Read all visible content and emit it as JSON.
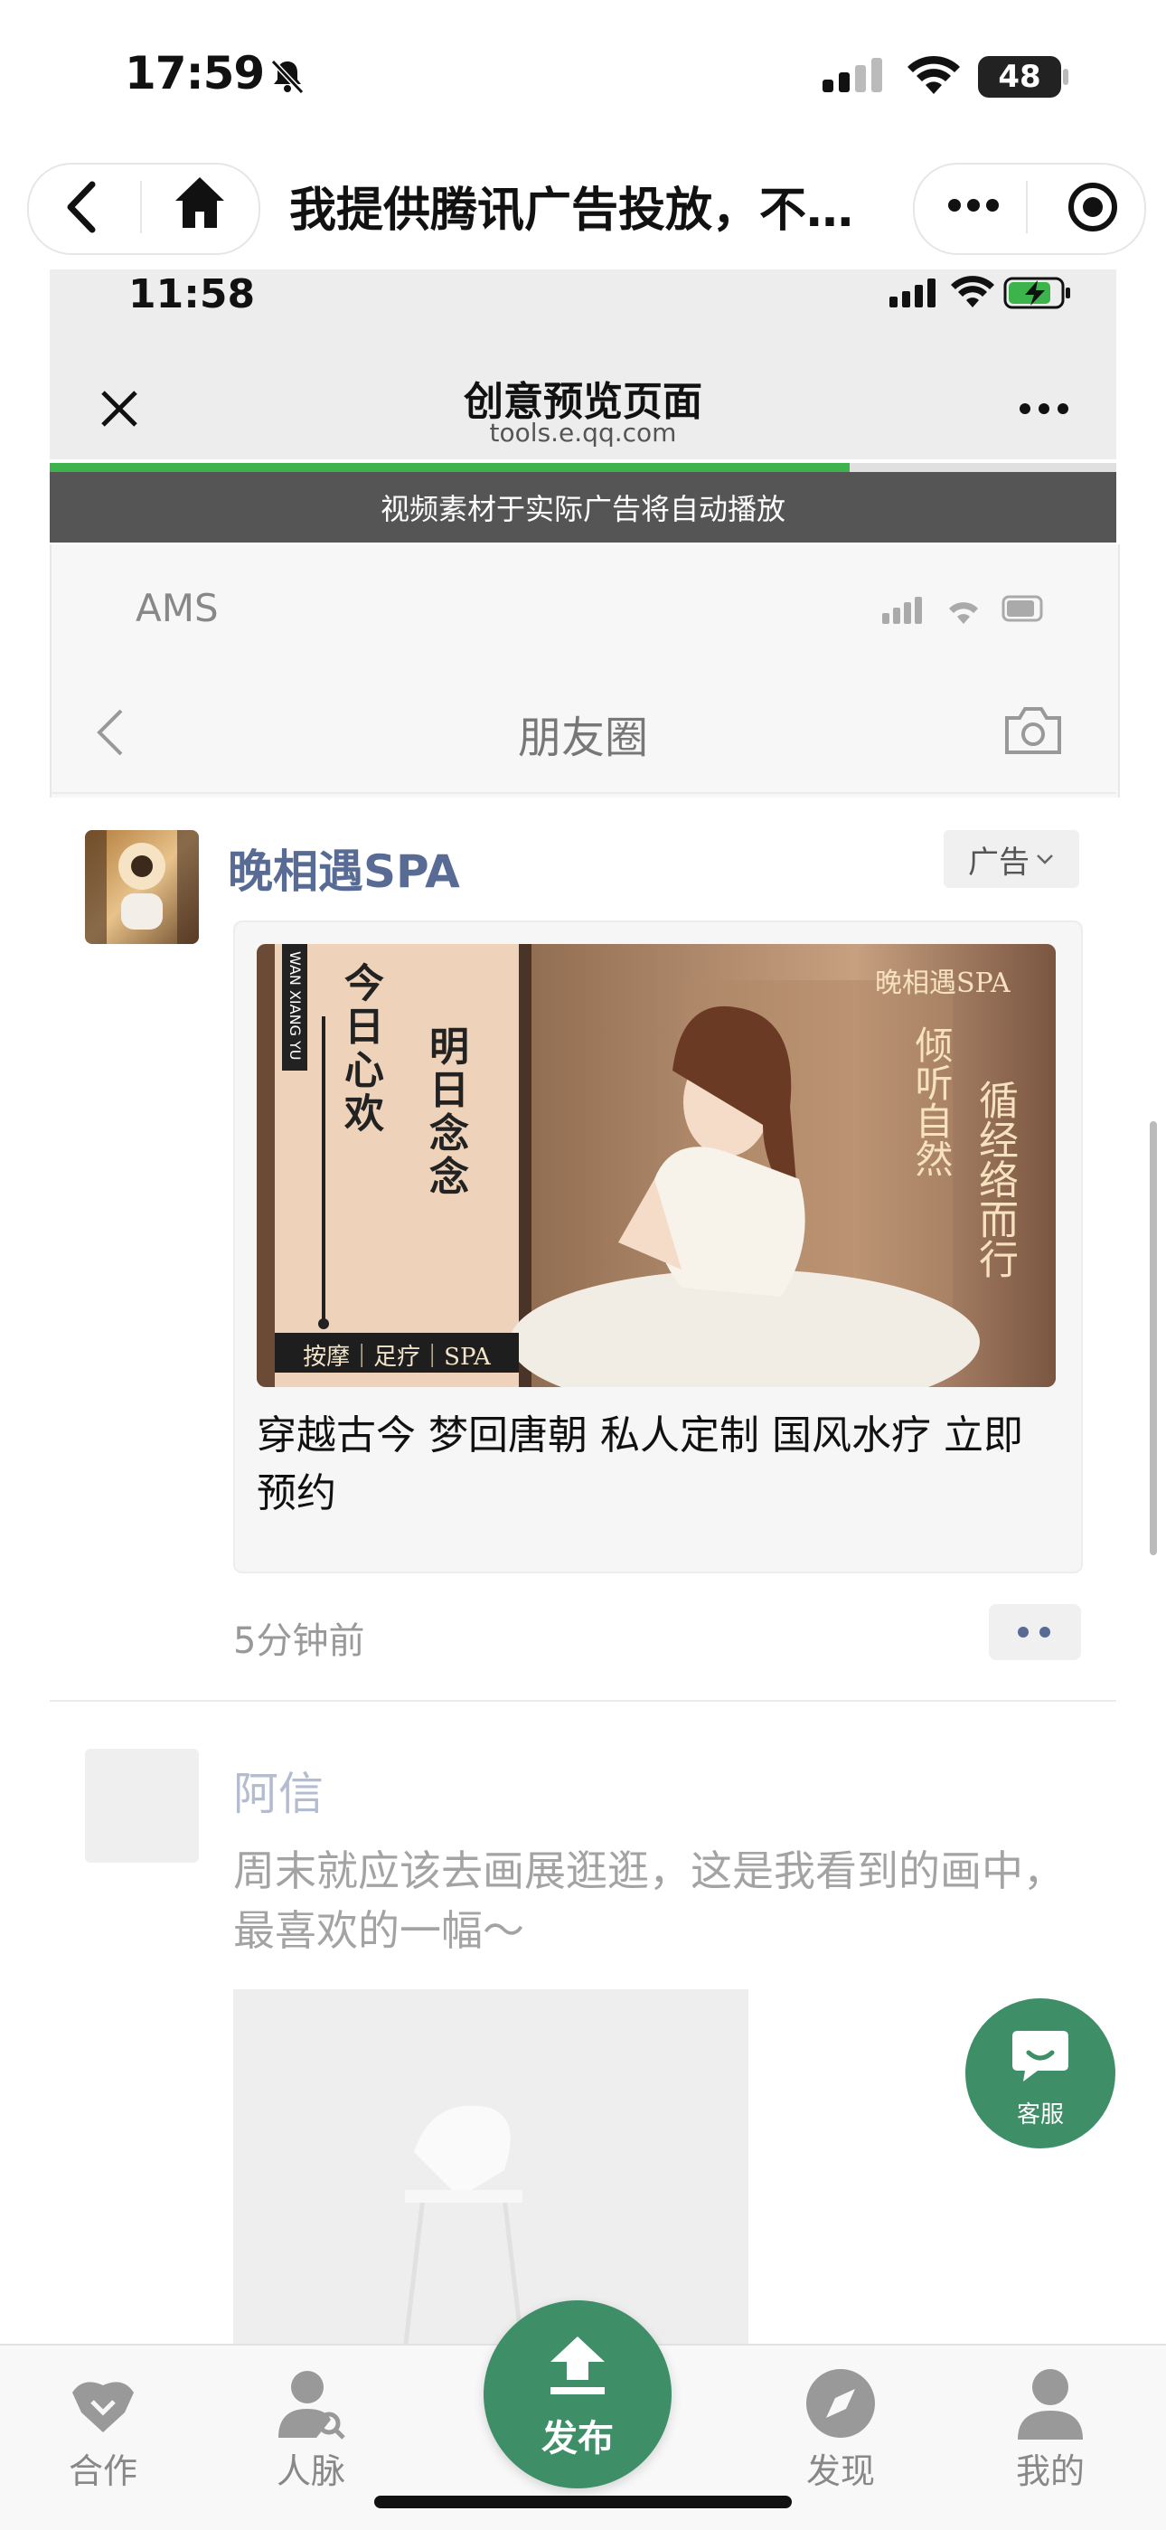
{
  "status_bar": {
    "time": "17:59",
    "battery": "48"
  },
  "mini_nav": {
    "title": "我提供腾讯广告投放，不…"
  },
  "preview": {
    "time": "11:58",
    "title": "创意预览页面",
    "domain": "tools.e.qq.com",
    "progress": 0.75,
    "notice": "视频素材于实际广告将自动播放"
  },
  "moments": {
    "carrier": "AMS",
    "title": "朋友圈"
  },
  "ad_post": {
    "advertiser": "晚相遇SPA",
    "ad_tag": "广告",
    "text": "穿越古今 梦回唐朝 私人定制 国风水疗 立即预约",
    "time_ago": "5分钟前",
    "image": {
      "brand": "晚相遇SPA",
      "headline_left_1": "今日心欢",
      "headline_left_2": "明日念念",
      "headline_right_1": "倾听自然",
      "headline_right_2": "循经络而行",
      "pinyin": "WAN XIANG YU",
      "bottom": "按摩｜足疗｜SPA"
    }
  },
  "second_post": {
    "name": "阿信",
    "text": "周末就应该去画展逛逛，这是我看到的画中，最喜欢的一幅～"
  },
  "service": {
    "label": "客服"
  },
  "tabbar": {
    "tabs": [
      {
        "label": "合作",
        "icon": "handshake-icon"
      },
      {
        "label": "人脉",
        "icon": "contacts-icon"
      },
      {
        "label": "发布",
        "icon": "upload-icon"
      },
      {
        "label": "发现",
        "icon": "compass-icon"
      },
      {
        "label": "我的",
        "icon": "profile-icon"
      }
    ]
  },
  "colors": {
    "accent": "#3e8e68",
    "link": "#576b95",
    "progress": "#3cb44b"
  }
}
